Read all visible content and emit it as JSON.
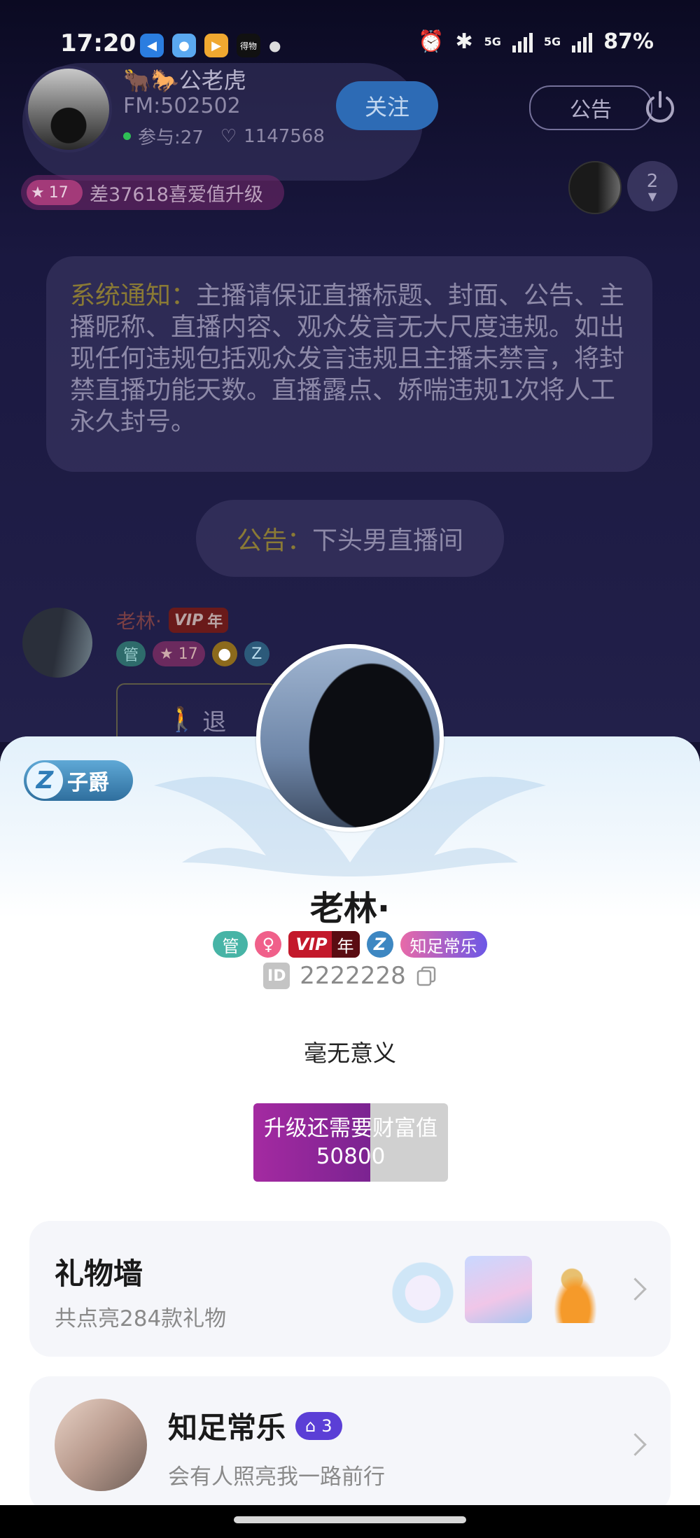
{
  "status_bar": {
    "time": "17:20",
    "battery": "87%",
    "signal_1": "5G",
    "signal_2": "5G",
    "app_icons": [
      "app-blue-icon",
      "app-bird-icon",
      "app-video-icon",
      "app-label-icon"
    ],
    "app_label_text": "得物"
  },
  "host": {
    "name": "🐂🐎公老虎",
    "fm": "FM:502502",
    "participants": "参与:27",
    "likes": "1147568",
    "follow_label": "关注",
    "notice_label": "公告"
  },
  "level_pill": {
    "level": "17",
    "text": "差37618喜爱值升级"
  },
  "viewers": {
    "count": "2"
  },
  "system_notice": {
    "label": "系统通知：",
    "text": "主播请保证直播标题、封面、公告、主播昵称、直播内容、观众发言无大尺度违规。如出现任何违规包括观众发言违规且主播未禁言，将封禁直播功能天数。直播露点、娇喘违规1次将人工永久封号。"
  },
  "announcement": {
    "label": "公告：",
    "text": "下头男直播间"
  },
  "chat_message": {
    "name": "老林·",
    "vip_label": "VIP",
    "vip_suffix": "年",
    "admin_badge": "管",
    "level": "17",
    "bubble_text": "退"
  },
  "profile": {
    "rank_badge": "子爵",
    "name": "老林·",
    "badges": {
      "admin": "管",
      "gender": "♀",
      "vip": "VIP",
      "vip_suffix": "年",
      "club": "知足常乐"
    },
    "id_label": "ID",
    "id_value": "2222228",
    "signature": "毫无意义",
    "wealth": {
      "line1": "升级还需要财富值",
      "line2": "50800",
      "progress": 0.6
    }
  },
  "gift_wall": {
    "title": "礼物墙",
    "subtitle": "共点亮284款礼物"
  },
  "club": {
    "name": "知足常乐",
    "level": "3",
    "subtitle": "会有人照亮我一路前行"
  },
  "colors": {
    "sheet_bg": "#ffffff",
    "wealth_fill": "#a42aa1",
    "club_level_bg": "#5b3fd6",
    "announce_label": "#8a7a35"
  }
}
